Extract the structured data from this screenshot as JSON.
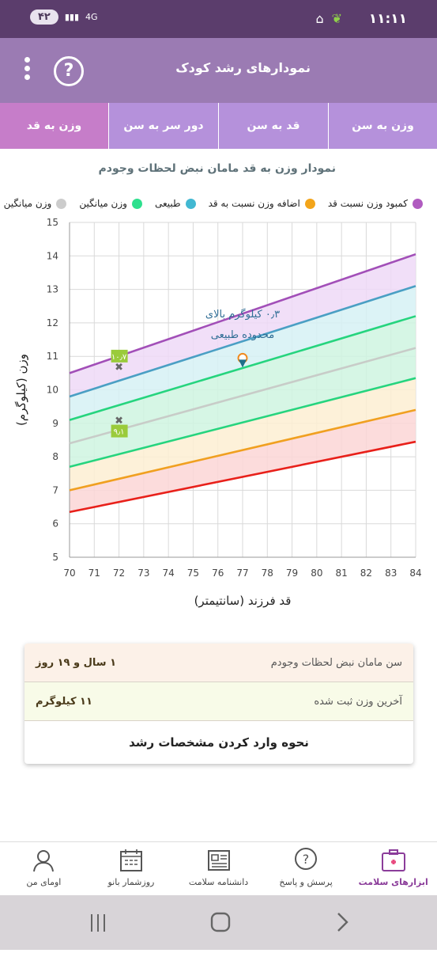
{
  "status_bar": {
    "time": "۱۱:۱۱",
    "notifications": "۴۲",
    "network": "4G"
  },
  "app_bar": {
    "title": "نمودارهای رشد کودک"
  },
  "tabs": [
    {
      "label": "وزن به سن",
      "active": false
    },
    {
      "label": "قد به سن",
      "active": false
    },
    {
      "label": "دور سر به سن",
      "active": false
    },
    {
      "label": "وزن به قد",
      "active": true
    }
  ],
  "chart_title": "نمودار وزن به قد مامان نبض لحظات وجودم",
  "legend": [
    {
      "label": "کمبود وزن نسبت قد",
      "color": "#b05bc0"
    },
    {
      "label": "اضافه وزن نسبت به قد",
      "color": "#f3a51a"
    },
    {
      "label": "طبیعی",
      "color": "#42b8d2"
    },
    {
      "label": "وزن میانگین",
      "color": "#2ee08e"
    }
  ],
  "legend_extra": {
    "label": "وزن میانگین",
    "color": "#cccccc"
  },
  "chart_data": {
    "type": "line",
    "xlabel": "قد فرزند (سانتیمتر)",
    "ylabel": "وزن (کیلوگرم)",
    "xlim": [
      70,
      84
    ],
    "ylim": [
      5,
      15
    ],
    "xticks": [
      70,
      71,
      72,
      73,
      74,
      75,
      76,
      77,
      78,
      79,
      80,
      81,
      82,
      83,
      84
    ],
    "yticks": [
      5,
      6,
      7,
      8,
      9,
      10,
      11,
      12,
      13,
      14,
      15
    ],
    "series": [
      {
        "color": "#a24fb8",
        "x": [
          70,
          84
        ],
        "y": [
          10.5,
          14.05
        ]
      },
      {
        "color": "#4a9fc4",
        "x": [
          70,
          84
        ],
        "y": [
          9.8,
          13.1
        ]
      },
      {
        "color": "#26d47e",
        "x": [
          70,
          84
        ],
        "y": [
          9.1,
          12.2
        ]
      },
      {
        "color": "#c8ccc8",
        "x": [
          70,
          84
        ],
        "y": [
          8.4,
          11.25
        ]
      },
      {
        "color": "#26d47e",
        "x": [
          70,
          84
        ],
        "y": [
          7.7,
          10.35
        ]
      },
      {
        "color": "#f0a020",
        "x": [
          70,
          84
        ],
        "y": [
          7.0,
          9.4
        ]
      },
      {
        "color": "#e8201a",
        "x": [
          70,
          84
        ],
        "y": [
          6.35,
          8.45
        ]
      }
    ],
    "bands": [
      {
        "upper": 0,
        "lower": 1,
        "fill": "#efd9f7"
      },
      {
        "upper": 1,
        "lower": 2,
        "fill": "#d6f1f4"
      },
      {
        "upper": 2,
        "lower": 4,
        "fill": "#cff5e0"
      },
      {
        "upper": 4,
        "lower": 5,
        "fill": "#fdeed2"
      },
      {
        "upper": 5,
        "lower": 6,
        "fill": "#fcd6d6"
      }
    ],
    "markers": [
      {
        "x": 72,
        "y": 10.7,
        "label": "۱۰٫۷"
      },
      {
        "x": 72,
        "y": 9.1,
        "label": "۹٫۱"
      }
    ],
    "point": {
      "x": 77,
      "y": 10.9
    },
    "annotation": {
      "line1": "۰٫۳ کیلوگرم بالای",
      "line2": "محدوده طبیعی"
    }
  },
  "info": {
    "age_label": "سن مامان نبض لحظات وجودم",
    "age_value": "۱ سال و ۱۹ روز",
    "weight_label": "آخرین وزن ثبت شده",
    "weight_value": "۱۱ کیلوگرم",
    "howto": "نحوه وارد کردن مشخصات رشد"
  },
  "bottom_nav": [
    {
      "label": "ابزارهای سلامت",
      "icon": "medkit-icon",
      "active": true
    },
    {
      "label": "پرسش و پاسخ",
      "icon": "question-bubble-icon",
      "active": false
    },
    {
      "label": "دانشنامه سلامت",
      "icon": "newspaper-icon",
      "active": false
    },
    {
      "label": "روزشمار بانو",
      "icon": "calendar-icon",
      "active": false
    },
    {
      "label": "اومای من",
      "icon": "profile-icon",
      "active": false
    }
  ]
}
